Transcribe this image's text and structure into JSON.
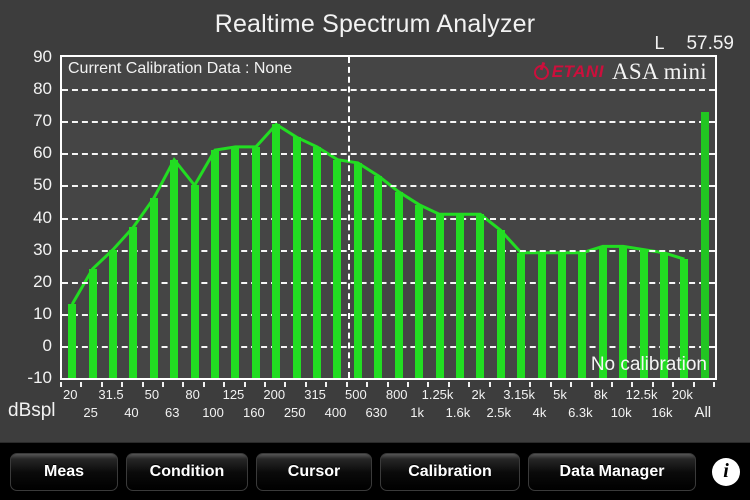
{
  "app": {
    "title": "Realtime Spectrum Analyzer",
    "logo_brand": "ETANI",
    "logo_product": "ASA mini",
    "brand_color": "#cc0f3c",
    "trace_color": "#22dd22",
    "background_color": "#3d3d3d",
    "plot_background_color": "#454545"
  },
  "readout": {
    "channel_label": "L",
    "level_value": "57.59"
  },
  "plot_overlay": {
    "calibration_banner": "Current Calibration Data : None",
    "no_calibration_note": "No calibration"
  },
  "axes": {
    "y_unit_label": "dBspl",
    "y_ticks": [
      "90",
      "80",
      "70",
      "60",
      "50",
      "40",
      "30",
      "20",
      "10",
      "0",
      "-10"
    ],
    "x_labels_upper": [
      "20",
      "31.5",
      "50",
      "80",
      "125",
      "200",
      "315",
      "500",
      "800",
      "1.25k",
      "2k",
      "3.15k",
      "5k",
      "8k",
      "12.5k",
      "20k"
    ],
    "x_labels_lower": [
      "25",
      "40",
      "63",
      "100",
      "160",
      "250",
      "400",
      "630",
      "1k",
      "1.6k",
      "2.5k",
      "4k",
      "6.3k",
      "10k",
      "16k"
    ],
    "x_label_all": "All"
  },
  "toolbar": {
    "meas": "Meas",
    "condition": "Condition",
    "cursor": "Cursor",
    "calibration": "Calibration",
    "data_manager": "Data Manager",
    "info_icon": "i"
  },
  "chart_data": {
    "type": "bar",
    "title": "Realtime Spectrum Analyzer",
    "xlabel": "",
    "ylabel": "dBspl",
    "ylim": [
      -10,
      90
    ],
    "ytick_step": 10,
    "grid": true,
    "categories": [
      "20",
      "25",
      "31.5",
      "40",
      "50",
      "63",
      "80",
      "100",
      "125",
      "160",
      "200",
      "250",
      "315",
      "400",
      "500",
      "630",
      "800",
      "1k",
      "1.25k",
      "1.6k",
      "2k",
      "2.5k",
      "3.15k",
      "4k",
      "5k",
      "6.3k",
      "8k",
      "10k",
      "12.5k",
      "16k",
      "20k",
      "All"
    ],
    "values": [
      13,
      24,
      30,
      37,
      46,
      58,
      50,
      61,
      62,
      62,
      69,
      65,
      62,
      58,
      57,
      53,
      48,
      44,
      41,
      41,
      41,
      36,
      29,
      29,
      29,
      29,
      31,
      31,
      30,
      29,
      27,
      73
    ],
    "overlay_line": {
      "name": "envelope",
      "color": "#22dd22",
      "follows_bar_tops": true
    },
    "cursor": {
      "visible": true,
      "orientation": "vertical",
      "at_category": "400",
      "style": "dashed"
    },
    "annotations": [
      {
        "text": "Current Calibration Data : None",
        "position": "top-left"
      },
      {
        "text": "No calibration",
        "position": "bottom-right"
      }
    ],
    "legend": {
      "visible": false
    }
  }
}
